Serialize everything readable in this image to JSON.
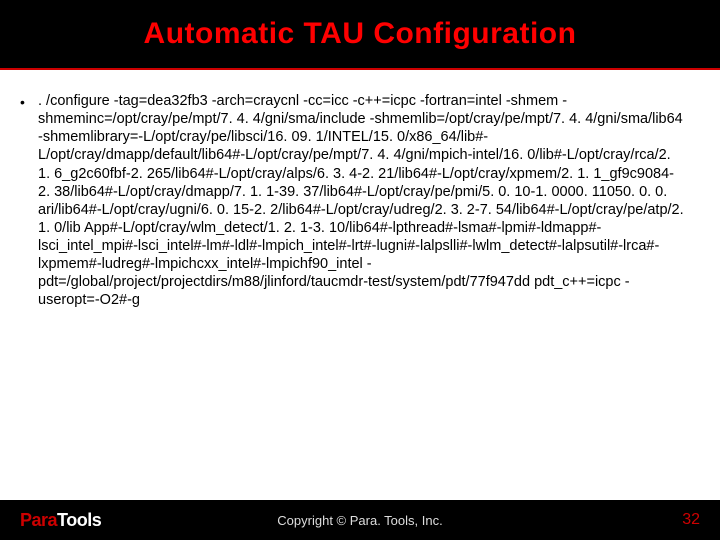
{
  "title": "Automatic TAU Configuration",
  "bullet_glyph": "•",
  "body": ". /configure -tag=dea32fb3 -arch=craycnl -cc=icc -c++=icpc -fortran=intel -shmem -shmeminc=/opt/cray/pe/mpt/7. 4. 4/gni/sma/include -shmemlib=/opt/cray/pe/mpt/7. 4. 4/gni/sma/lib64 -shmemlibrary=-L/opt/cray/pe/libsci/16. 09. 1/INTEL/15. 0/x86_64/lib#-L/opt/cray/dmapp/default/lib64#-L/opt/cray/pe/mpt/7. 4. 4/gni/mpich-intel/16. 0/lib#-L/opt/cray/rca/2. 1. 6_g2c60fbf-2. 265/lib64#-L/opt/cray/alps/6. 3. 4-2. 21/lib64#-L/opt/cray/xpmem/2. 1. 1_gf9c9084-2. 38/lib64#-L/opt/cray/dmapp/7. 1. 1-39. 37/lib64#-L/opt/cray/pe/pmi/5. 0. 10-1. 0000. 11050. 0. 0. ari/lib64#-L/opt/cray/ugni/6. 0. 15-2. 2/lib64#-L/opt/cray/udreg/2. 3. 2-7. 54/lib64#-L/opt/cray/pe/atp/2. 1. 0/lib App#-L/opt/cray/wlm_detect/1. 2. 1-3. 10/lib64#-lpthread#-lsma#-lpmi#-ldmapp#-lsci_intel_mpi#-lsci_intel#-lm#-ldl#-lmpich_intel#-lrt#-lugni#-lalpslli#-lwlm_detect#-lalpsutil#-lrca#-lxpmem#-ludreg#-lmpichcxx_intel#-lmpichf90_intel -pdt=/global/project/projectdirs/m88/jlinford/taucmdr-test/system/pdt/77f947dd pdt_c++=icpc -useropt=-O2#-g",
  "footer": {
    "logo_para": "Para",
    "logo_tools": "Tools",
    "copyright": "Copyright © Para. Tools, Inc.",
    "page": "32"
  }
}
